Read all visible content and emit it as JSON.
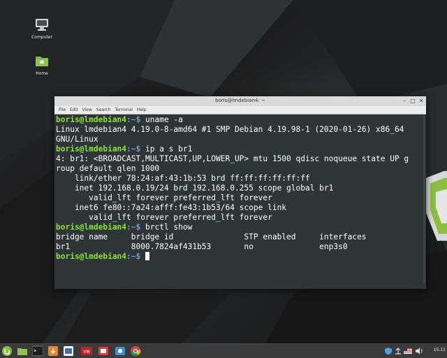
{
  "desktop": {
    "icons": [
      {
        "label": "Computer",
        "icon": "computer-icon"
      },
      {
        "label": "Home",
        "icon": "home-folder-icon"
      }
    ]
  },
  "terminal": {
    "title": "boris@lmdebian4: ~",
    "menu": [
      "File",
      "Edit",
      "View",
      "Search",
      "Terminal",
      "Help"
    ],
    "prompt_user": "boris@lmdebian4",
    "prompt_path": ":~$",
    "lines": [
      {
        "kind": "prompt",
        "cmd": " uname -a"
      },
      {
        "kind": "out",
        "text": "Linux lmdebian4 4.19.0-8-amd64 #1 SMP Debian 4.19.98-1 (2020-01-26) x86_64"
      },
      {
        "kind": "out",
        "text": "GNU/Linux"
      },
      {
        "kind": "prompt",
        "cmd": " ip a s br1"
      },
      {
        "kind": "out",
        "text": "4: br1: <BROADCAST,MULTICAST,UP,LOWER_UP> mtu 1500 qdisc noqueue state UP g"
      },
      {
        "kind": "out",
        "text": "roup default qlen 1000"
      },
      {
        "kind": "out",
        "text": "    link/ether 78:24:af:43:1b:53 brd ff:ff:ff:ff:ff:ff"
      },
      {
        "kind": "out",
        "text": "    inet 192.168.0.19/24 brd 192.168.0.255 scope global br1"
      },
      {
        "kind": "out",
        "text": "       valid_lft forever preferred_lft forever"
      },
      {
        "kind": "out",
        "text": "    inet6 fe80::7a24:afff:fe43:1b53/64 scope link"
      },
      {
        "kind": "out",
        "text": "       valid_lft forever preferred_lft forever"
      },
      {
        "kind": "prompt",
        "cmd": " brctl show"
      },
      {
        "kind": "out",
        "text": "bridge name     bridge id               STP enabled     interfaces"
      },
      {
        "kind": "out",
        "text": "br1             8000.7824af431b53       no              enp3s0"
      },
      {
        "kind": "prompt",
        "cmd": " "
      }
    ]
  },
  "panel": {
    "launchers": [
      "mint-menu-icon",
      "files-icon",
      "terminal-icon",
      "updater-icon",
      "virtualbox-icon",
      "app-icon",
      "screenshot-icon",
      "chrome-icon"
    ],
    "tray": [
      "shield-icon",
      "network-icon",
      "us-flag-icon",
      "volume-icon"
    ],
    "clock": "15:11"
  },
  "colors": {
    "prompt_user": "#8ae234",
    "prompt_path": "#729fcf",
    "terminal_bg": "#2f3436",
    "panel_bg": "#3a3a3a"
  }
}
